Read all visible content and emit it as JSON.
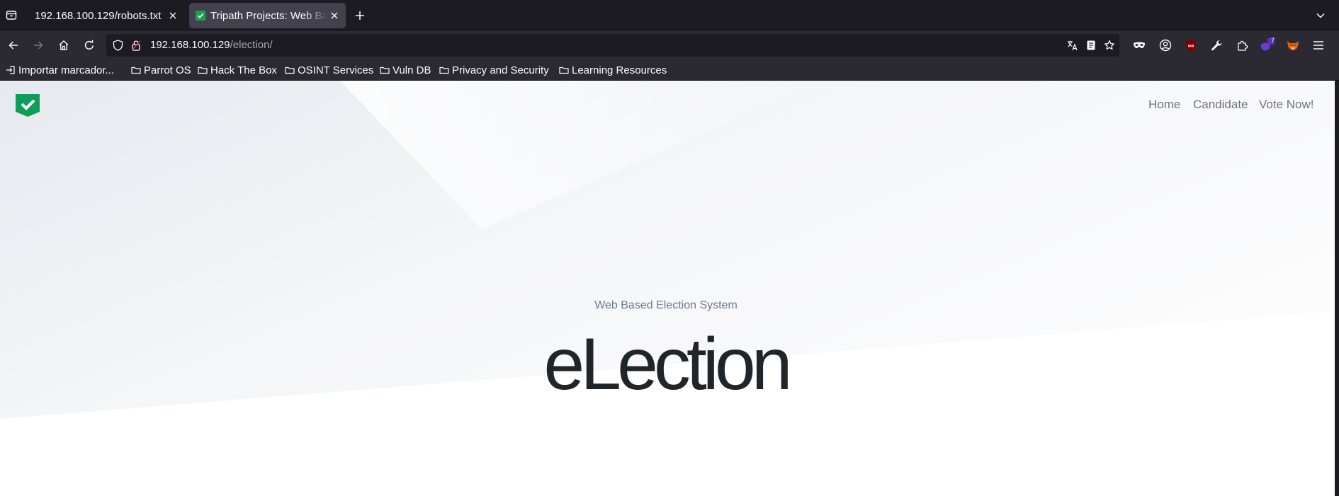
{
  "browser": {
    "tabs": [
      {
        "title": "192.168.100.129/robots.txt",
        "active": false
      },
      {
        "title": "Tripath Projects: Web Based Election System",
        "active": true
      }
    ],
    "url": {
      "host": "192.168.100.129",
      "path": "/election/"
    },
    "extension_badge": "7",
    "bookmarks": [
      {
        "label": "Importar marcador...",
        "icon": "import-icon"
      },
      {
        "label": "Parrot OS",
        "icon": "folder-icon"
      },
      {
        "label": "Hack The Box",
        "icon": "folder-icon"
      },
      {
        "label": "OSINT Services",
        "icon": "folder-icon"
      },
      {
        "label": "Vuln DB",
        "icon": "folder-icon"
      },
      {
        "label": "Privacy and Security",
        "icon": "folder-icon"
      },
      {
        "label": "Learning Resources",
        "icon": "folder-icon"
      }
    ]
  },
  "site": {
    "logo_icon": "check-flag-icon",
    "brand_color": "#0f9d58",
    "nav": [
      "Home",
      "Candidate",
      "Vote Now!"
    ],
    "subtitle": "Web Based Election System",
    "headline": "eLection"
  }
}
